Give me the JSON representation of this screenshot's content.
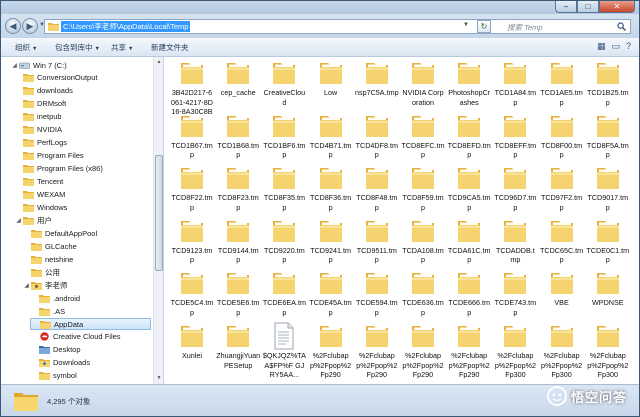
{
  "address": {
    "path": "C:\\Users\\李老师\\AppData\\Local\\Temp",
    "search_placeholder": "搜索 Temp"
  },
  "window_buttons": {
    "minimize": "–",
    "maximize": "□",
    "close": "✕"
  },
  "toolbar": {
    "organize": "组织",
    "include_in_library": "包含到库中",
    "share": "共享",
    "new_folder": "新建文件夹"
  },
  "nav": {
    "items": [
      {
        "label": "Win 7 (C:)",
        "icon": "drive-icon",
        "level": 0,
        "expander": "◢"
      },
      {
        "label": "ConversionOutput",
        "icon": "folder-icon",
        "level": 1
      },
      {
        "label": "downloads",
        "icon": "folder-icon",
        "level": 1
      },
      {
        "label": "DRMsoft",
        "icon": "folder-icon",
        "level": 1
      },
      {
        "label": "inetpub",
        "icon": "folder-icon",
        "level": 1
      },
      {
        "label": "NVIDIA",
        "icon": "folder-icon",
        "level": 1
      },
      {
        "label": "PerfLogs",
        "icon": "folder-icon",
        "level": 1
      },
      {
        "label": "Program Files",
        "icon": "folder-icon",
        "level": 1
      },
      {
        "label": "Program Files (x86)",
        "icon": "folder-icon",
        "level": 1
      },
      {
        "label": "Tencent",
        "icon": "folder-icon",
        "level": 1
      },
      {
        "label": "WEXAM",
        "icon": "folder-icon",
        "level": 1
      },
      {
        "label": "Windows",
        "icon": "folder-icon",
        "level": 1
      },
      {
        "label": "用户",
        "icon": "folder-icon",
        "level": 1,
        "expander": "◢"
      },
      {
        "label": "DefaultAppPool",
        "icon": "folder-icon",
        "level": 2
      },
      {
        "label": "GLCache",
        "icon": "folder-icon",
        "level": 2
      },
      {
        "label": "netshine",
        "icon": "folder-icon",
        "level": 2
      },
      {
        "label": "公用",
        "icon": "folder-icon",
        "level": 2
      },
      {
        "label": "李老师",
        "icon": "user-folder-icon",
        "level": 2,
        "expander": "◢"
      },
      {
        "label": ".android",
        "icon": "folder-icon",
        "level": 3
      },
      {
        "label": ".AS",
        "icon": "folder-icon",
        "level": 3
      },
      {
        "label": "AppData",
        "icon": "folder-icon",
        "level": 3,
        "selected": true
      },
      {
        "label": "Creative Cloud Files",
        "icon": "creative-cloud-icon",
        "level": 3
      },
      {
        "label": "Desktop",
        "icon": "desktop-folder-icon",
        "level": 3
      },
      {
        "label": "Downloads",
        "icon": "downloads-folder-icon",
        "level": 3
      },
      {
        "label": "symbol",
        "icon": "folder-icon",
        "level": 3
      }
    ]
  },
  "files": [
    "3B42D217-6061-4217-8D16-8A30C8B0D...",
    "cep_cache",
    "CreativeCloud",
    "Low",
    "nsp7C5A.tmp",
    "NVIDIA Corporation",
    "PhotoshopCrashes",
    "TCD1A84.tmp",
    "TCD1AE5.tmp",
    "TCD1B25.tmp",
    "TCD1B67.tmp",
    "TCD1B68.tmp",
    "TCD1BF6.tmp",
    "TCD4B71.tmp",
    "TCD4DF8.tmp",
    "TCD8EFC.tmp",
    "TCD8EFD.tmp",
    "TCD8EFF.tmp",
    "TCD8F00.tmp",
    "TCD8F5A.tmp",
    "TCD8F22.tmp",
    "TCD8F23.tmp",
    "TCD8F35.tmp",
    "TCD8F36.tmp",
    "TCD8F48.tmp",
    "TCD8F59.tmp",
    "TCD9CA5.tmp",
    "TCD96D7.tmp",
    "TCD97F2.tmp",
    "TCD9017.tmp",
    "TCD9123.tmp",
    "TCD9144.tmp",
    "TCD9220.tmp",
    "TCD9241.tmp",
    "TCD9511.tmp",
    "TCDA108.tmp",
    "TCDA61C.tmp",
    "TCDADDB.tmp",
    "TCDC65C.tmp",
    "TCDE0C1.tmp",
    "TCDE5C4.tmp",
    "TCDE5E6.tmp",
    "TCDE6EA.tmp",
    "TCDE45A.tmp",
    "TCDE594.tmp",
    "TCDE636.tmp",
    "TCDE666.tmp",
    "TCDE743.tmp",
    "VBE",
    "WPDNSE",
    "Xunlei",
    "ZhuangjiYuanPESetup",
    "$QKJQZ%TAA$FP%F GJRY5AA...",
    "%2Fclubapp%2Fpop%2Fp290",
    "%2Fclubapp%2Fpop%2Fp290",
    "%2Fclubapp%2Fpop%2Fp290",
    "%2Fclubapp%2Fpop%2Fp290",
    "%2Fclubapp%2Fpop%2Fp300",
    "%2Fclubapp%2Fpop%2Fp300",
    "%2Fclubapp%2Fpop%2Fp300"
  ],
  "file_icon_types": {
    "52": "text-file-icon"
  },
  "status": {
    "count": "4,295 个对象"
  },
  "watermark": {
    "text": "悟空问答"
  },
  "colors": {
    "selection": "#3399ff",
    "folder": "#f2c94c",
    "accent": "#cfdcea"
  }
}
